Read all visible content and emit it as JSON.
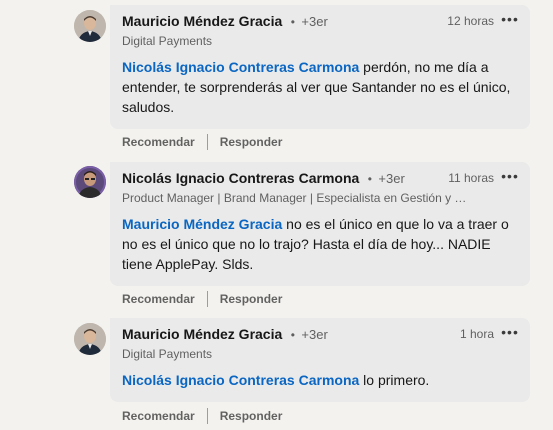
{
  "comments": [
    {
      "author": "Mauricio Méndez Gracia",
      "dot": "•",
      "degree": "+3er",
      "headline": "Digital Payments",
      "time": "12 horas",
      "more": "•••",
      "mention": "Nicolás Ignacio Contreras Carmona",
      "text": " perdón, no me día a entender, te sorprenderás al ver que Santander no es el único, saludos.",
      "like_label": "Recomendar",
      "reply_label": "Responder"
    },
    {
      "author": "Nicolás Ignacio Contreras Carmona",
      "dot": "•",
      "degree": "+3er",
      "headline": "Product Manager | Brand Manager | Especialista en Gestión y D...",
      "time": "11 horas",
      "more": "•••",
      "mention": "Mauricio Méndez Gracia",
      "text": " no es el único en que lo va a traer o no es el único que no lo trajo? Hasta el día de hoy... NADIE tiene ApplePay. Slds.",
      "like_label": "Recomendar",
      "reply_label": "Responder"
    },
    {
      "author": "Mauricio Méndez Gracia",
      "dot": "•",
      "degree": "+3er",
      "headline": "Digital Payments",
      "time": "1 hora",
      "more": "•••",
      "mention": "Nicolás Ignacio Contreras Carmona",
      "text": " lo primero.",
      "like_label": "Recomendar",
      "reply_label": "Responder"
    }
  ]
}
